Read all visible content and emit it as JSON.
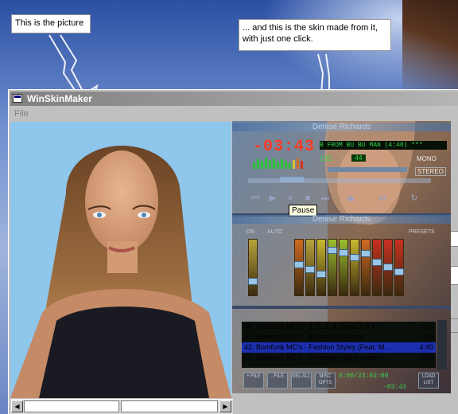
{
  "callouts": {
    "picture": "This is the picture",
    "skin": "... and this is the skin made from it, with just one click."
  },
  "window": {
    "title": "WinSkinMaker",
    "menu_file": "File",
    "icon": "window-icon"
  },
  "skin": {
    "player_title": "Denise Richards",
    "equalizer_title": "Denise Richards",
    "time": "-03:43",
    "marquee": "B FROM BU BU MAN (4:40)  ***",
    "kbps": "192",
    "khz": "44",
    "mono": "MONO",
    "stereo": "STEREO",
    "tooltip": "Pause",
    "eq_on": "ON",
    "eq_auto": "AUTO",
    "eq_presets": "PRESETS",
    "eq_levels": [
      0.2,
      0.55,
      0.45,
      0.35,
      0.85,
      0.8,
      0.7,
      0.78,
      0.6,
      0.5,
      0.4
    ],
    "playlist": [
      {
        "title": "40. Bomfunk MC's - 1, 2, 3, 4 (Feat. J.A.K. f...",
        "time": "4:05",
        "selected": false
      },
      {
        "title": "41. Bomfunk MC's - B-Boys & Flygirls",
        "time": "3:14",
        "selected": false
      },
      {
        "title": "42. Bomfunk MC's - Fashion Styley (Feat. M...",
        "time": "4:40",
        "selected": true
      },
      {
        "title": "43. Bomfunk MC's - Freestyler (dirty rotten s...",
        "time": "3:59",
        "selected": false
      }
    ],
    "pl_buttons": [
      "+ FILE",
      "- FILE",
      "SEL ALL",
      "MISC OPTS"
    ],
    "pl_load": "LOAD LIST",
    "pl_total": "0:00/23:02:00",
    "pl_elapsed": "-03:43"
  },
  "colors": {
    "accent": "#000080",
    "titlebar_inactive": "#808080"
  }
}
